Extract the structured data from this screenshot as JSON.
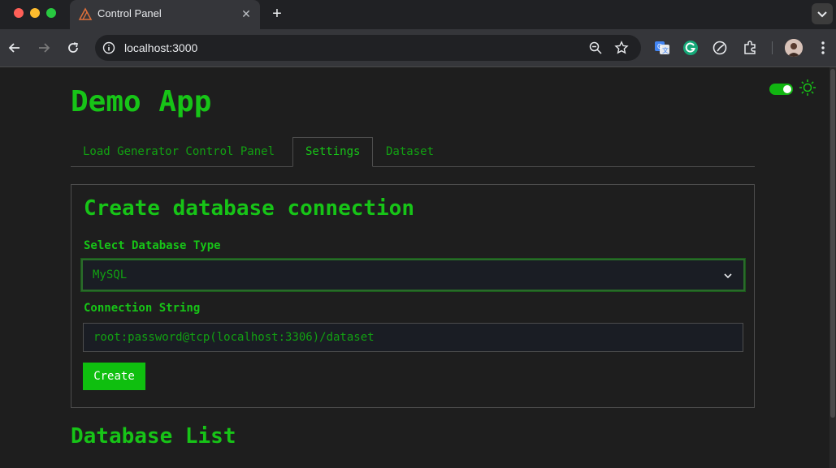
{
  "browser": {
    "tab_title": "Control Panel",
    "url": "localhost:3000"
  },
  "app": {
    "title": "Demo App",
    "theme_toggle_on": true
  },
  "tabs": [
    {
      "label": "Load Generator Control Panel",
      "active": false
    },
    {
      "label": "Settings",
      "active": true
    },
    {
      "label": "Dataset",
      "active": false
    }
  ],
  "form": {
    "title": "Create database connection",
    "db_type_label": "Select Database Type",
    "db_type_value": "MySQL",
    "conn_label": "Connection String",
    "conn_value": "root:password@tcp(localhost:3306)/dataset",
    "create_label": "Create"
  },
  "list": {
    "title": "Database List"
  },
  "colors": {
    "accent": "#17c417",
    "button": "#0fbf0f",
    "background": "#1e1e1e"
  }
}
